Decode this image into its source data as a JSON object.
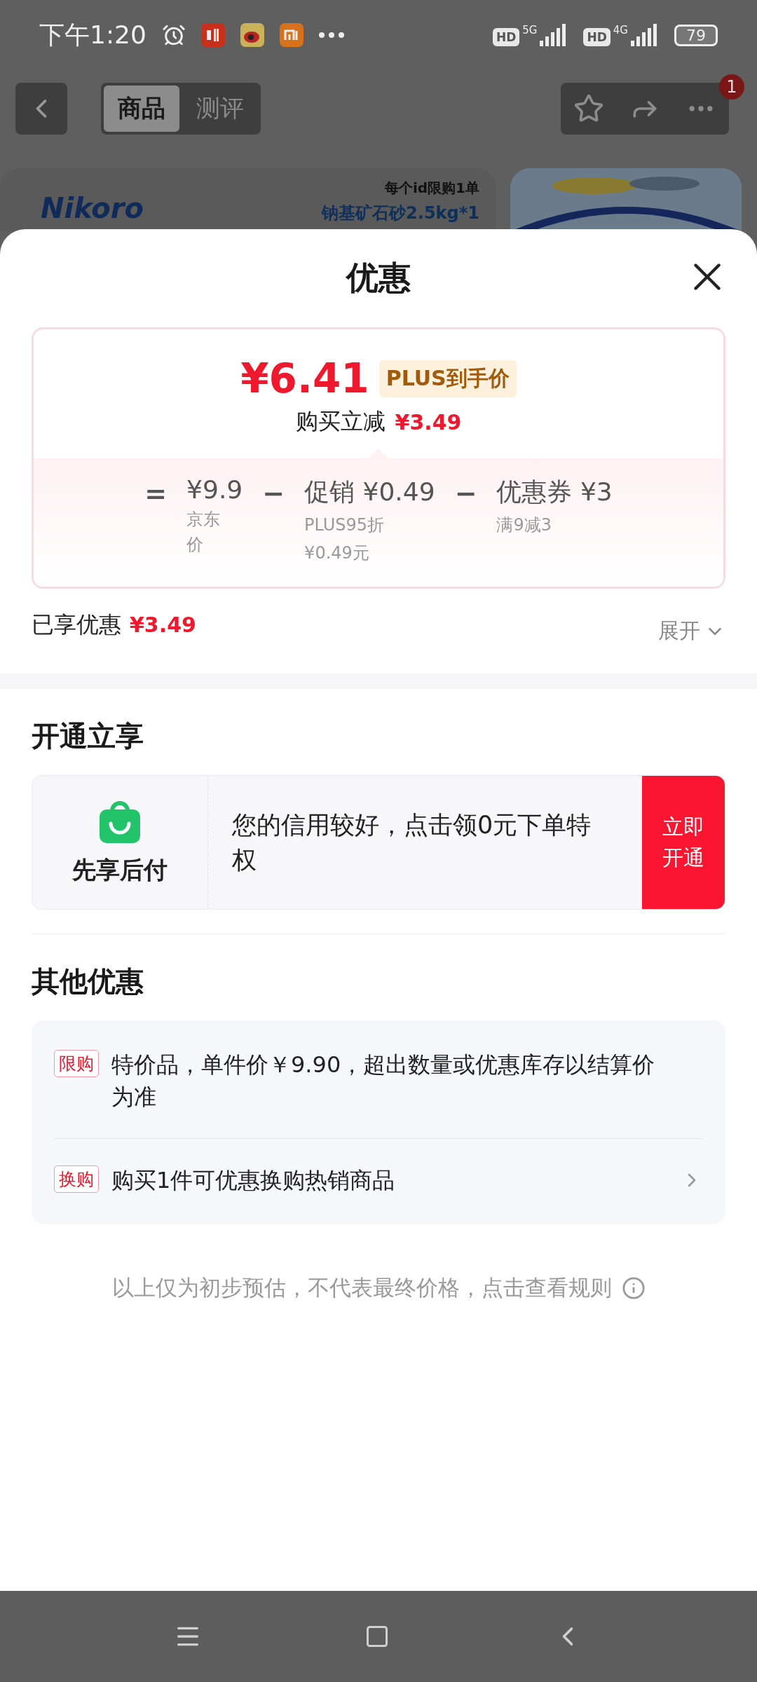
{
  "status_bar": {
    "time": "下午1:20",
    "signals": [
      {
        "badge": "HD",
        "network": "5G"
      },
      {
        "badge": "HD",
        "network": "4G"
      }
    ],
    "battery": "79"
  },
  "header": {
    "tabs": [
      {
        "label": "商品",
        "selected": true
      },
      {
        "label": "测评",
        "selected": false
      }
    ],
    "badge": "1"
  },
  "banner": {
    "brand": "Nikoro",
    "note": "每个id限购1单",
    "product": "钠基矿石砂2.5kg*1"
  },
  "sheet": {
    "title": "优惠"
  },
  "price_card": {
    "final_price": "¥6.41",
    "price_tag": "PLUS到手价",
    "reduction_label": "购买立减",
    "reduction": "¥3.49",
    "terms": [
      {
        "operator": "=",
        "amount": "¥9.9",
        "notes": [
          "京东价"
        ]
      },
      {
        "operator": "−",
        "label": "促销",
        "amount": "¥0.49",
        "notes": [
          "PLUS95折",
          "¥0.49元"
        ]
      },
      {
        "operator": "−",
        "label": "优惠券",
        "amount": "¥3",
        "notes": [
          "满9减3"
        ]
      }
    ]
  },
  "enjoyed": {
    "label": "已享优惠",
    "amount": "¥3.49",
    "expand": "展开"
  },
  "open_section": {
    "title": "开通立享",
    "service": "先享后付",
    "message": "您的信用较好，点击领0元下单特权",
    "button": "立即开通"
  },
  "other_section": {
    "title": "其他优惠",
    "items": [
      {
        "tag": "限购",
        "text": "特价品，单件价￥9.90，超出数量或优惠库存以结算价为准",
        "link": false
      },
      {
        "tag": "换购",
        "text": "购买1件可优惠换购热销商品",
        "link": true
      }
    ]
  },
  "footer": "以上仅为初步预估，不代表最终价格，点击查看规则"
}
